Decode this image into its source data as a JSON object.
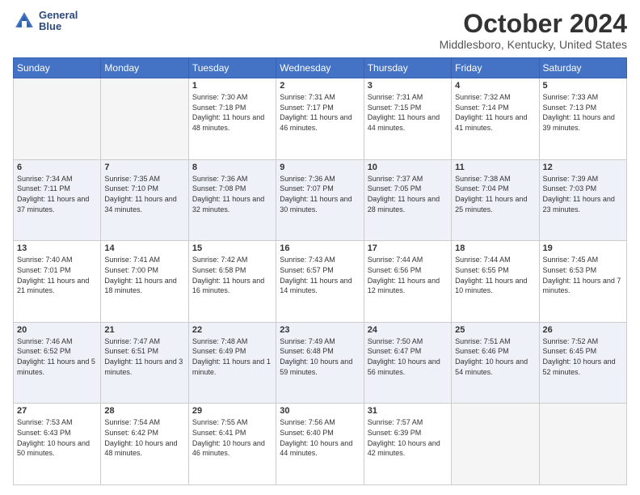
{
  "logo": {
    "line1": "General",
    "line2": "Blue"
  },
  "title": "October 2024",
  "subtitle": "Middlesboro, Kentucky, United States",
  "days_of_week": [
    "Sunday",
    "Monday",
    "Tuesday",
    "Wednesday",
    "Thursday",
    "Friday",
    "Saturday"
  ],
  "weeks": [
    [
      {
        "day": "",
        "sunrise": "",
        "sunset": "",
        "daylight": ""
      },
      {
        "day": "",
        "sunrise": "",
        "sunset": "",
        "daylight": ""
      },
      {
        "day": "1",
        "sunrise": "Sunrise: 7:30 AM",
        "sunset": "Sunset: 7:18 PM",
        "daylight": "Daylight: 11 hours and 48 minutes."
      },
      {
        "day": "2",
        "sunrise": "Sunrise: 7:31 AM",
        "sunset": "Sunset: 7:17 PM",
        "daylight": "Daylight: 11 hours and 46 minutes."
      },
      {
        "day": "3",
        "sunrise": "Sunrise: 7:31 AM",
        "sunset": "Sunset: 7:15 PM",
        "daylight": "Daylight: 11 hours and 44 minutes."
      },
      {
        "day": "4",
        "sunrise": "Sunrise: 7:32 AM",
        "sunset": "Sunset: 7:14 PM",
        "daylight": "Daylight: 11 hours and 41 minutes."
      },
      {
        "day": "5",
        "sunrise": "Sunrise: 7:33 AM",
        "sunset": "Sunset: 7:13 PM",
        "daylight": "Daylight: 11 hours and 39 minutes."
      }
    ],
    [
      {
        "day": "6",
        "sunrise": "Sunrise: 7:34 AM",
        "sunset": "Sunset: 7:11 PM",
        "daylight": "Daylight: 11 hours and 37 minutes."
      },
      {
        "day": "7",
        "sunrise": "Sunrise: 7:35 AM",
        "sunset": "Sunset: 7:10 PM",
        "daylight": "Daylight: 11 hours and 34 minutes."
      },
      {
        "day": "8",
        "sunrise": "Sunrise: 7:36 AM",
        "sunset": "Sunset: 7:08 PM",
        "daylight": "Daylight: 11 hours and 32 minutes."
      },
      {
        "day": "9",
        "sunrise": "Sunrise: 7:36 AM",
        "sunset": "Sunset: 7:07 PM",
        "daylight": "Daylight: 11 hours and 30 minutes."
      },
      {
        "day": "10",
        "sunrise": "Sunrise: 7:37 AM",
        "sunset": "Sunset: 7:05 PM",
        "daylight": "Daylight: 11 hours and 28 minutes."
      },
      {
        "day": "11",
        "sunrise": "Sunrise: 7:38 AM",
        "sunset": "Sunset: 7:04 PM",
        "daylight": "Daylight: 11 hours and 25 minutes."
      },
      {
        "day": "12",
        "sunrise": "Sunrise: 7:39 AM",
        "sunset": "Sunset: 7:03 PM",
        "daylight": "Daylight: 11 hours and 23 minutes."
      }
    ],
    [
      {
        "day": "13",
        "sunrise": "Sunrise: 7:40 AM",
        "sunset": "Sunset: 7:01 PM",
        "daylight": "Daylight: 11 hours and 21 minutes."
      },
      {
        "day": "14",
        "sunrise": "Sunrise: 7:41 AM",
        "sunset": "Sunset: 7:00 PM",
        "daylight": "Daylight: 11 hours and 18 minutes."
      },
      {
        "day": "15",
        "sunrise": "Sunrise: 7:42 AM",
        "sunset": "Sunset: 6:58 PM",
        "daylight": "Daylight: 11 hours and 16 minutes."
      },
      {
        "day": "16",
        "sunrise": "Sunrise: 7:43 AM",
        "sunset": "Sunset: 6:57 PM",
        "daylight": "Daylight: 11 hours and 14 minutes."
      },
      {
        "day": "17",
        "sunrise": "Sunrise: 7:44 AM",
        "sunset": "Sunset: 6:56 PM",
        "daylight": "Daylight: 11 hours and 12 minutes."
      },
      {
        "day": "18",
        "sunrise": "Sunrise: 7:44 AM",
        "sunset": "Sunset: 6:55 PM",
        "daylight": "Daylight: 11 hours and 10 minutes."
      },
      {
        "day": "19",
        "sunrise": "Sunrise: 7:45 AM",
        "sunset": "Sunset: 6:53 PM",
        "daylight": "Daylight: 11 hours and 7 minutes."
      }
    ],
    [
      {
        "day": "20",
        "sunrise": "Sunrise: 7:46 AM",
        "sunset": "Sunset: 6:52 PM",
        "daylight": "Daylight: 11 hours and 5 minutes."
      },
      {
        "day": "21",
        "sunrise": "Sunrise: 7:47 AM",
        "sunset": "Sunset: 6:51 PM",
        "daylight": "Daylight: 11 hours and 3 minutes."
      },
      {
        "day": "22",
        "sunrise": "Sunrise: 7:48 AM",
        "sunset": "Sunset: 6:49 PM",
        "daylight": "Daylight: 11 hours and 1 minute."
      },
      {
        "day": "23",
        "sunrise": "Sunrise: 7:49 AM",
        "sunset": "Sunset: 6:48 PM",
        "daylight": "Daylight: 10 hours and 59 minutes."
      },
      {
        "day": "24",
        "sunrise": "Sunrise: 7:50 AM",
        "sunset": "Sunset: 6:47 PM",
        "daylight": "Daylight: 10 hours and 56 minutes."
      },
      {
        "day": "25",
        "sunrise": "Sunrise: 7:51 AM",
        "sunset": "Sunset: 6:46 PM",
        "daylight": "Daylight: 10 hours and 54 minutes."
      },
      {
        "day": "26",
        "sunrise": "Sunrise: 7:52 AM",
        "sunset": "Sunset: 6:45 PM",
        "daylight": "Daylight: 10 hours and 52 minutes."
      }
    ],
    [
      {
        "day": "27",
        "sunrise": "Sunrise: 7:53 AM",
        "sunset": "Sunset: 6:43 PM",
        "daylight": "Daylight: 10 hours and 50 minutes."
      },
      {
        "day": "28",
        "sunrise": "Sunrise: 7:54 AM",
        "sunset": "Sunset: 6:42 PM",
        "daylight": "Daylight: 10 hours and 48 minutes."
      },
      {
        "day": "29",
        "sunrise": "Sunrise: 7:55 AM",
        "sunset": "Sunset: 6:41 PM",
        "daylight": "Daylight: 10 hours and 46 minutes."
      },
      {
        "day": "30",
        "sunrise": "Sunrise: 7:56 AM",
        "sunset": "Sunset: 6:40 PM",
        "daylight": "Daylight: 10 hours and 44 minutes."
      },
      {
        "day": "31",
        "sunrise": "Sunrise: 7:57 AM",
        "sunset": "Sunset: 6:39 PM",
        "daylight": "Daylight: 10 hours and 42 minutes."
      },
      {
        "day": "",
        "sunrise": "",
        "sunset": "",
        "daylight": ""
      },
      {
        "day": "",
        "sunrise": "",
        "sunset": "",
        "daylight": ""
      }
    ]
  ]
}
